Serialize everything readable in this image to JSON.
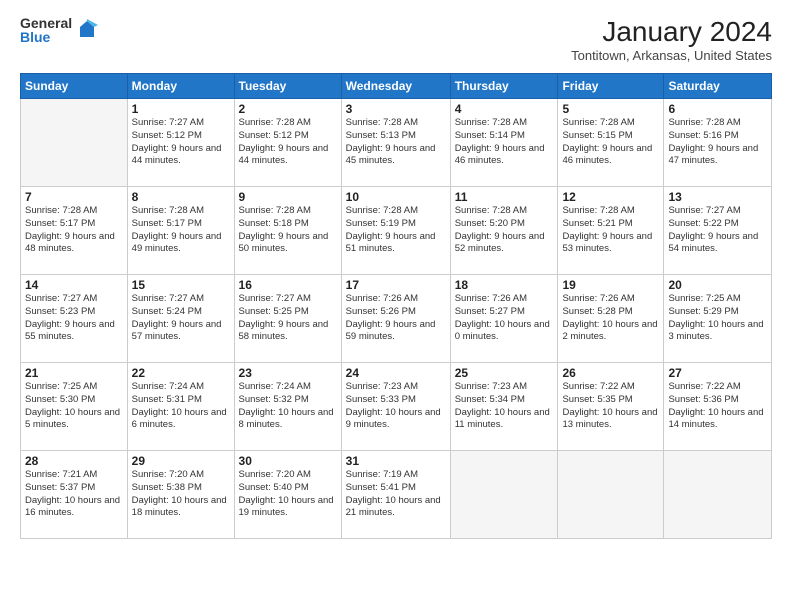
{
  "logo": {
    "general": "General",
    "blue": "Blue"
  },
  "title": "January 2024",
  "location": "Tontitown, Arkansas, United States",
  "weekdays": [
    "Sunday",
    "Monday",
    "Tuesday",
    "Wednesday",
    "Thursday",
    "Friday",
    "Saturday"
  ],
  "weeks": [
    [
      {
        "num": "",
        "sunrise": "",
        "sunset": "",
        "daylight": ""
      },
      {
        "num": "1",
        "sunrise": "Sunrise: 7:27 AM",
        "sunset": "Sunset: 5:12 PM",
        "daylight": "Daylight: 9 hours and 44 minutes."
      },
      {
        "num": "2",
        "sunrise": "Sunrise: 7:28 AM",
        "sunset": "Sunset: 5:12 PM",
        "daylight": "Daylight: 9 hours and 44 minutes."
      },
      {
        "num": "3",
        "sunrise": "Sunrise: 7:28 AM",
        "sunset": "Sunset: 5:13 PM",
        "daylight": "Daylight: 9 hours and 45 minutes."
      },
      {
        "num": "4",
        "sunrise": "Sunrise: 7:28 AM",
        "sunset": "Sunset: 5:14 PM",
        "daylight": "Daylight: 9 hours and 46 minutes."
      },
      {
        "num": "5",
        "sunrise": "Sunrise: 7:28 AM",
        "sunset": "Sunset: 5:15 PM",
        "daylight": "Daylight: 9 hours and 46 minutes."
      },
      {
        "num": "6",
        "sunrise": "Sunrise: 7:28 AM",
        "sunset": "Sunset: 5:16 PM",
        "daylight": "Daylight: 9 hours and 47 minutes."
      }
    ],
    [
      {
        "num": "7",
        "sunrise": "Sunrise: 7:28 AM",
        "sunset": "Sunset: 5:17 PM",
        "daylight": "Daylight: 9 hours and 48 minutes."
      },
      {
        "num": "8",
        "sunrise": "Sunrise: 7:28 AM",
        "sunset": "Sunset: 5:17 PM",
        "daylight": "Daylight: 9 hours and 49 minutes."
      },
      {
        "num": "9",
        "sunrise": "Sunrise: 7:28 AM",
        "sunset": "Sunset: 5:18 PM",
        "daylight": "Daylight: 9 hours and 50 minutes."
      },
      {
        "num": "10",
        "sunrise": "Sunrise: 7:28 AM",
        "sunset": "Sunset: 5:19 PM",
        "daylight": "Daylight: 9 hours and 51 minutes."
      },
      {
        "num": "11",
        "sunrise": "Sunrise: 7:28 AM",
        "sunset": "Sunset: 5:20 PM",
        "daylight": "Daylight: 9 hours and 52 minutes."
      },
      {
        "num": "12",
        "sunrise": "Sunrise: 7:28 AM",
        "sunset": "Sunset: 5:21 PM",
        "daylight": "Daylight: 9 hours and 53 minutes."
      },
      {
        "num": "13",
        "sunrise": "Sunrise: 7:27 AM",
        "sunset": "Sunset: 5:22 PM",
        "daylight": "Daylight: 9 hours and 54 minutes."
      }
    ],
    [
      {
        "num": "14",
        "sunrise": "Sunrise: 7:27 AM",
        "sunset": "Sunset: 5:23 PM",
        "daylight": "Daylight: 9 hours and 55 minutes."
      },
      {
        "num": "15",
        "sunrise": "Sunrise: 7:27 AM",
        "sunset": "Sunset: 5:24 PM",
        "daylight": "Daylight: 9 hours and 57 minutes."
      },
      {
        "num": "16",
        "sunrise": "Sunrise: 7:27 AM",
        "sunset": "Sunset: 5:25 PM",
        "daylight": "Daylight: 9 hours and 58 minutes."
      },
      {
        "num": "17",
        "sunrise": "Sunrise: 7:26 AM",
        "sunset": "Sunset: 5:26 PM",
        "daylight": "Daylight: 9 hours and 59 minutes."
      },
      {
        "num": "18",
        "sunrise": "Sunrise: 7:26 AM",
        "sunset": "Sunset: 5:27 PM",
        "daylight": "Daylight: 10 hours and 0 minutes."
      },
      {
        "num": "19",
        "sunrise": "Sunrise: 7:26 AM",
        "sunset": "Sunset: 5:28 PM",
        "daylight": "Daylight: 10 hours and 2 minutes."
      },
      {
        "num": "20",
        "sunrise": "Sunrise: 7:25 AM",
        "sunset": "Sunset: 5:29 PM",
        "daylight": "Daylight: 10 hours and 3 minutes."
      }
    ],
    [
      {
        "num": "21",
        "sunrise": "Sunrise: 7:25 AM",
        "sunset": "Sunset: 5:30 PM",
        "daylight": "Daylight: 10 hours and 5 minutes."
      },
      {
        "num": "22",
        "sunrise": "Sunrise: 7:24 AM",
        "sunset": "Sunset: 5:31 PM",
        "daylight": "Daylight: 10 hours and 6 minutes."
      },
      {
        "num": "23",
        "sunrise": "Sunrise: 7:24 AM",
        "sunset": "Sunset: 5:32 PM",
        "daylight": "Daylight: 10 hours and 8 minutes."
      },
      {
        "num": "24",
        "sunrise": "Sunrise: 7:23 AM",
        "sunset": "Sunset: 5:33 PM",
        "daylight": "Daylight: 10 hours and 9 minutes."
      },
      {
        "num": "25",
        "sunrise": "Sunrise: 7:23 AM",
        "sunset": "Sunset: 5:34 PM",
        "daylight": "Daylight: 10 hours and 11 minutes."
      },
      {
        "num": "26",
        "sunrise": "Sunrise: 7:22 AM",
        "sunset": "Sunset: 5:35 PM",
        "daylight": "Daylight: 10 hours and 13 minutes."
      },
      {
        "num": "27",
        "sunrise": "Sunrise: 7:22 AM",
        "sunset": "Sunset: 5:36 PM",
        "daylight": "Daylight: 10 hours and 14 minutes."
      }
    ],
    [
      {
        "num": "28",
        "sunrise": "Sunrise: 7:21 AM",
        "sunset": "Sunset: 5:37 PM",
        "daylight": "Daylight: 10 hours and 16 minutes."
      },
      {
        "num": "29",
        "sunrise": "Sunrise: 7:20 AM",
        "sunset": "Sunset: 5:38 PM",
        "daylight": "Daylight: 10 hours and 18 minutes."
      },
      {
        "num": "30",
        "sunrise": "Sunrise: 7:20 AM",
        "sunset": "Sunset: 5:40 PM",
        "daylight": "Daylight: 10 hours and 19 minutes."
      },
      {
        "num": "31",
        "sunrise": "Sunrise: 7:19 AM",
        "sunset": "Sunset: 5:41 PM",
        "daylight": "Daylight: 10 hours and 21 minutes."
      },
      {
        "num": "",
        "sunrise": "",
        "sunset": "",
        "daylight": ""
      },
      {
        "num": "",
        "sunrise": "",
        "sunset": "",
        "daylight": ""
      },
      {
        "num": "",
        "sunrise": "",
        "sunset": "",
        "daylight": ""
      }
    ]
  ]
}
